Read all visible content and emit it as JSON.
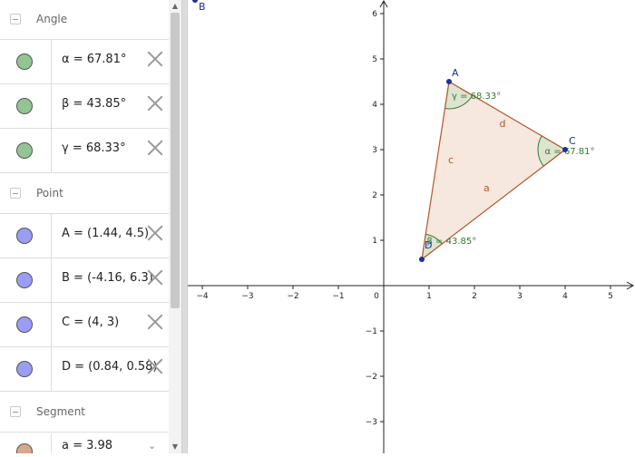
{
  "algebra": {
    "groups": [
      {
        "title": "Angle",
        "items": [
          {
            "label": "α = 67.81°",
            "color": "#93c493"
          },
          {
            "label": "β = 43.85°",
            "color": "#93c493"
          },
          {
            "label": "γ = 68.33°",
            "color": "#93c493"
          }
        ]
      },
      {
        "title": "Point",
        "items": [
          {
            "label": "A = (1.44, 4.5)",
            "color": "#9a9cf5"
          },
          {
            "label": "B = (-4.16, 6.3)",
            "color": "#9a9cf5"
          },
          {
            "label": "C = (4, 3)",
            "color": "#9a9cf5"
          },
          {
            "label": "D = (0.84, 0.58)",
            "color": "#9a9cf5"
          }
        ]
      },
      {
        "title": "Segment",
        "items": [
          {
            "label": "a = 3.98",
            "color": "#d8a88c"
          }
        ]
      }
    ]
  },
  "graphics": {
    "x_ticks": [
      "−4",
      "−3",
      "−2",
      "−1",
      "0",
      "1",
      "2",
      "3",
      "4",
      "5"
    ],
    "y_ticks": [
      "6",
      "5",
      "4",
      "3",
      "2",
      "1",
      "−1",
      "−2",
      "−3"
    ],
    "points": [
      {
        "name": "A",
        "x": 1.44,
        "y": 4.5
      },
      {
        "name": "B",
        "x": -4.16,
        "y": 6.3
      },
      {
        "name": "C",
        "x": 4,
        "y": 3
      },
      {
        "name": "D",
        "x": 0.84,
        "y": 0.58
      }
    ],
    "segments": [
      {
        "name": "a"
      },
      {
        "name": "c"
      },
      {
        "name": "d"
      }
    ],
    "angles": [
      {
        "label": "α = 67.81°"
      },
      {
        "label": "β = 43.85°"
      },
      {
        "label": "γ = 68.33°"
      }
    ],
    "colors": {
      "point": "#1a2fa0",
      "segment": "#b5582e",
      "angle": "#2f7a2f",
      "fill": "#f5e4dc"
    }
  }
}
